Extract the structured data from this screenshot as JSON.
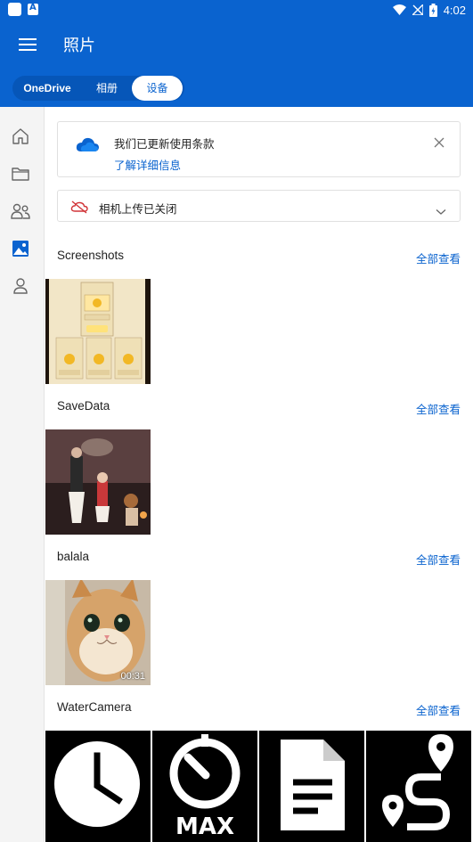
{
  "status_bar": {
    "time": "4:02"
  },
  "app_bar": {
    "title": "照片",
    "tabs": [
      {
        "label": "OneDrive"
      },
      {
        "label": "相册"
      },
      {
        "label": "设备",
        "selected": true
      }
    ]
  },
  "sidebar": {
    "items": [
      {
        "icon": "home-icon"
      },
      {
        "icon": "folder-icon"
      },
      {
        "icon": "people-icon"
      },
      {
        "icon": "photos-icon",
        "selected": true
      },
      {
        "icon": "me-icon"
      }
    ]
  },
  "notice": {
    "message": "我们已更新使用条款",
    "link": "了解详细信息"
  },
  "camera_upload": {
    "label": "相机上传已关闭"
  },
  "sections": [
    {
      "title": "Screenshots",
      "view_all": "全部查看"
    },
    {
      "title": "SaveData",
      "view_all": "全部查看"
    },
    {
      "title": "balala",
      "view_all": "全部查看",
      "video_duration": "00:31"
    },
    {
      "title": "WaterCamera",
      "view_all": "全部查看"
    }
  ],
  "screenshot_thumb": {
    "cells": [
      "1次抽奖",
      "2次抽奖",
      "3次抽奖",
      "6次抽奖",
      "8次抽奖"
    ]
  },
  "watercamera_icons": [
    "clock-icon",
    "stopwatch-max-icon",
    "document-icon",
    "route-icon"
  ],
  "watercamera_label": "MAX",
  "colors": {
    "accent": "#0a63cf",
    "accent_dark": "#0656b8",
    "rail": "#f4f4f4",
    "offline_red": "#d13438"
  }
}
